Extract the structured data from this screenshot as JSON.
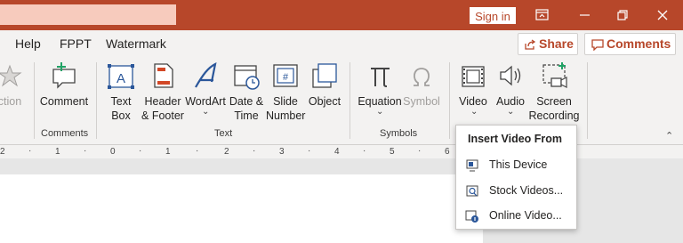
{
  "titlebar": {
    "signin_label": "Sign in"
  },
  "tabs": [
    {
      "label": "Help"
    },
    {
      "label": "FPPT"
    },
    {
      "label": "Watermark"
    }
  ],
  "share_label": "Share",
  "comments_label": "Comments",
  "ribbon": {
    "partial_label": "ction",
    "buttons": {
      "comment": "Comment",
      "text_box": "Text\nBox",
      "header_footer": "Header\n& Footer",
      "wordart": "WordArt",
      "date_time": "Date &\nTime",
      "slide_number": "Slide\nNumber",
      "object": "Object",
      "equation": "Equation",
      "symbol": "Symbol",
      "video": "Video",
      "audio": "Audio",
      "screen_recording": "Screen\nRecording"
    },
    "groups": {
      "comments": "Comments",
      "text": "Text",
      "symbols": "Symbols"
    }
  },
  "ruler": {
    "ticks": [
      "2",
      "1",
      "0",
      "1",
      "2",
      "3",
      "4",
      "5",
      "6"
    ]
  },
  "video_menu": {
    "title": "Insert Video From",
    "items": [
      {
        "label": "This Device",
        "icon": "device-video-icon"
      },
      {
        "label": "Stock Videos...",
        "icon": "stock-video-icon"
      },
      {
        "label": "Online Video...",
        "icon": "online-video-icon"
      }
    ]
  },
  "colors": {
    "titlebar": "#b7472a",
    "accent": "#b7472a",
    "icon_blue": "#2b579a"
  }
}
